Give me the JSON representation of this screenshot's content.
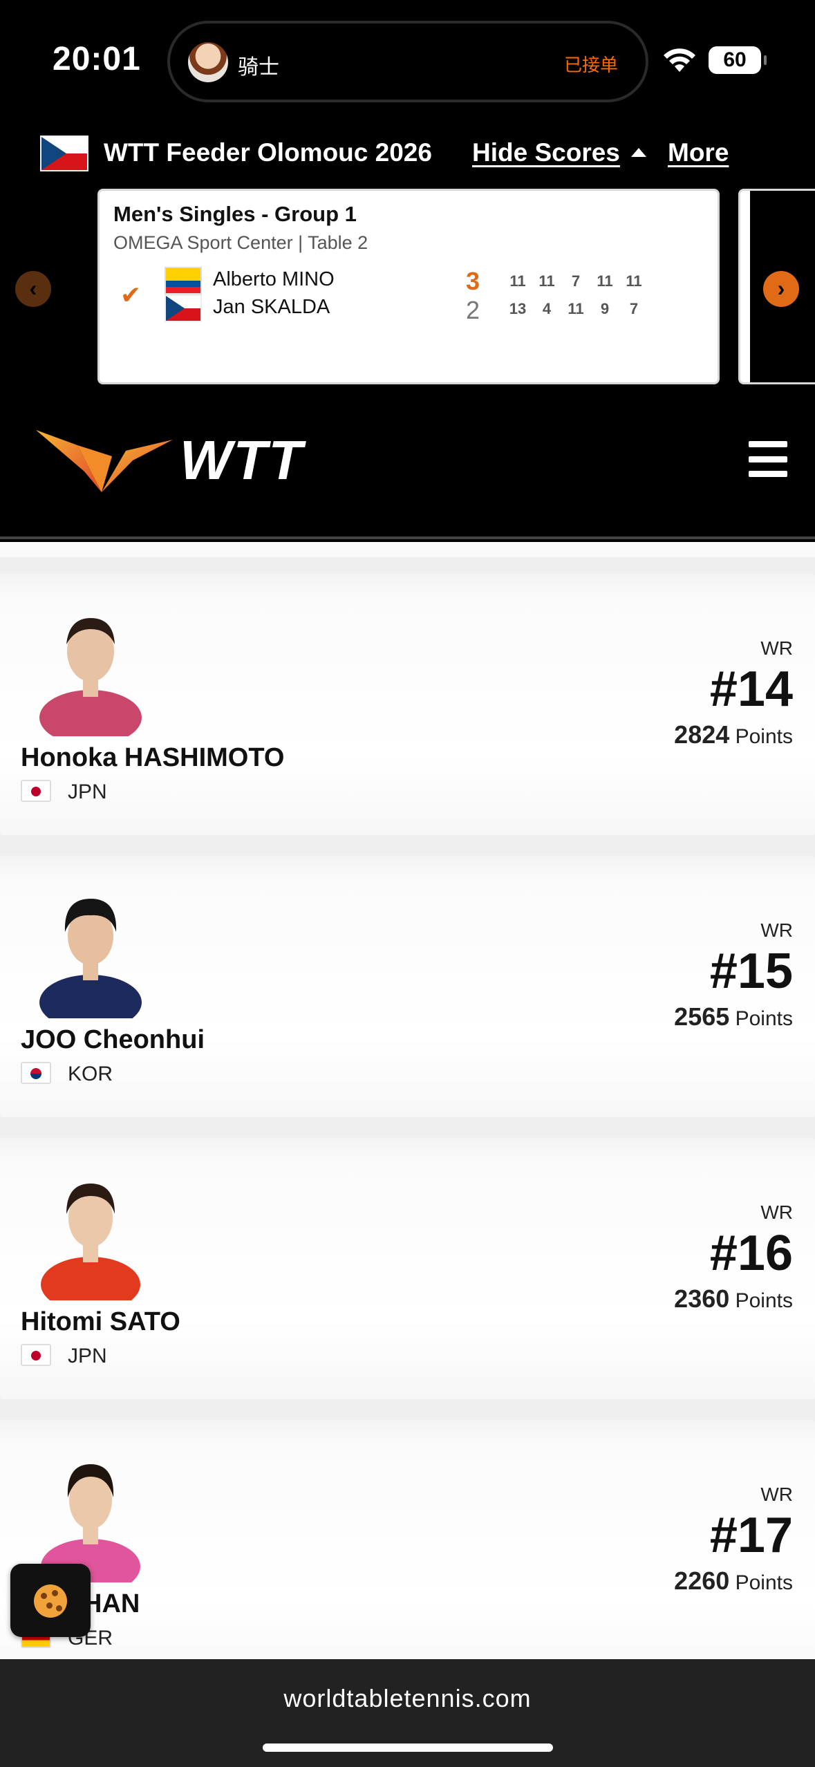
{
  "status_bar": {
    "time": "20:01",
    "island_name": "骑士",
    "island_tag": "已接单",
    "battery": "60"
  },
  "event": {
    "title": "WTT Feeder Olomouc 2026",
    "hide_scores": "Hide Scores",
    "more": "More"
  },
  "match": {
    "title": "Men's Singles - Group 1",
    "venue": "OMEGA Sport Center | Table 2",
    "players": [
      {
        "name": "Alberto MINO",
        "sets": "3",
        "games": [
          "11",
          "11",
          "7",
          "11",
          "11"
        ],
        "winner": true,
        "color": "#e06a16"
      },
      {
        "name": "Jan SKALDA",
        "sets": "2",
        "games": [
          "13",
          "4",
          "11",
          "9",
          "7"
        ],
        "winner": false,
        "color": "#777777"
      }
    ]
  },
  "brand": {
    "logo_text": "WTT",
    "accent": "#e06a16"
  },
  "rankings": [
    {
      "name": "Honoka HASHIMOTO",
      "country": "JPN",
      "wr_label": "WR",
      "rank": "#14",
      "points": "2824",
      "points_label": "Points"
    },
    {
      "name": "JOO Cheonhui",
      "country": "KOR",
      "wr_label": "WR",
      "rank": "#15",
      "points": "2565",
      "points_label": "Points"
    },
    {
      "name": "Hitomi SATO",
      "country": "JPN",
      "wr_label": "WR",
      "rank": "#16",
      "points": "2360",
      "points_label": "Points"
    },
    {
      "name": "HAN",
      "country": "GER",
      "wr_label": "WR",
      "rank": "#17",
      "points": "2260",
      "points_label": "Points"
    }
  ],
  "browser": {
    "url": "worldtabletennis.com"
  }
}
